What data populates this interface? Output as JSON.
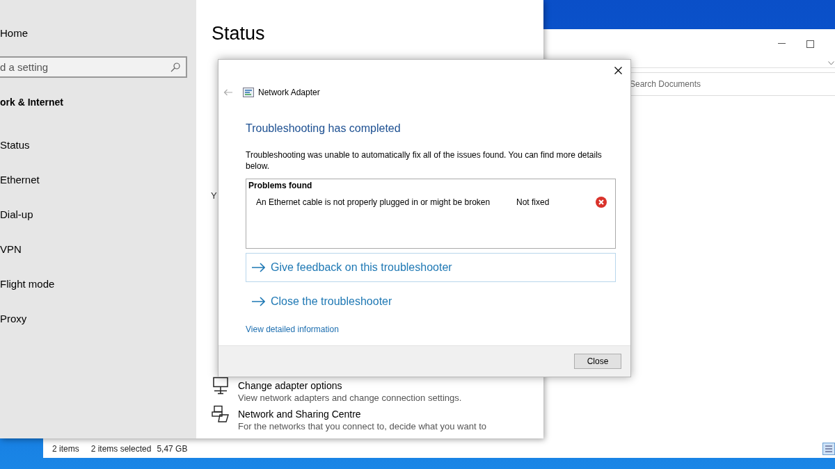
{
  "settings_window": {
    "sidebar": {
      "home": "Home",
      "search": {
        "placeholder": "d a setting"
      },
      "category": "ork & Internet",
      "items": [
        {
          "label": "Status"
        },
        {
          "label": "Ethernet"
        },
        {
          "label": "Dial-up"
        },
        {
          "label": "VPN"
        },
        {
          "label": "Flight mode"
        },
        {
          "label": "Proxy"
        }
      ]
    },
    "content": {
      "title": "Status",
      "partial_texts": [
        {
          "text": "Y",
          "kind": "body"
        }
      ],
      "links": [
        {
          "kind": "monitor",
          "title": "Change adapter options",
          "description": "View network adapters and change connection settings."
        },
        {
          "kind": "sharing",
          "title": "Network and Sharing Centre",
          "description": "For the networks that you connect to, decide what you want to"
        }
      ]
    }
  },
  "explorer_window": {
    "search": {
      "placeholder": "Search Documents"
    },
    "status_bar": {
      "item_count": "2 items",
      "selection": "2 items selected",
      "size": "5,47 GB"
    }
  },
  "dialog": {
    "title": "Network Adapter",
    "heading": "Troubleshooting has completed",
    "message": "Troubleshooting was unable to automatically fix all of the issues found. You can find more details below.",
    "problems": {
      "header": "Problems found",
      "rows": [
        {
          "problem": "An Ethernet cable is not properly plugged in or might be broken",
          "status": "Not fixed",
          "fixed": false
        }
      ]
    },
    "actions": [
      {
        "label": "Give feedback on this troubleshooter",
        "focused": true
      },
      {
        "label": "Close the troubleshooter",
        "focused": false
      }
    ],
    "details_link": "View detailed information",
    "buttons": [
      "Close"
    ]
  }
}
